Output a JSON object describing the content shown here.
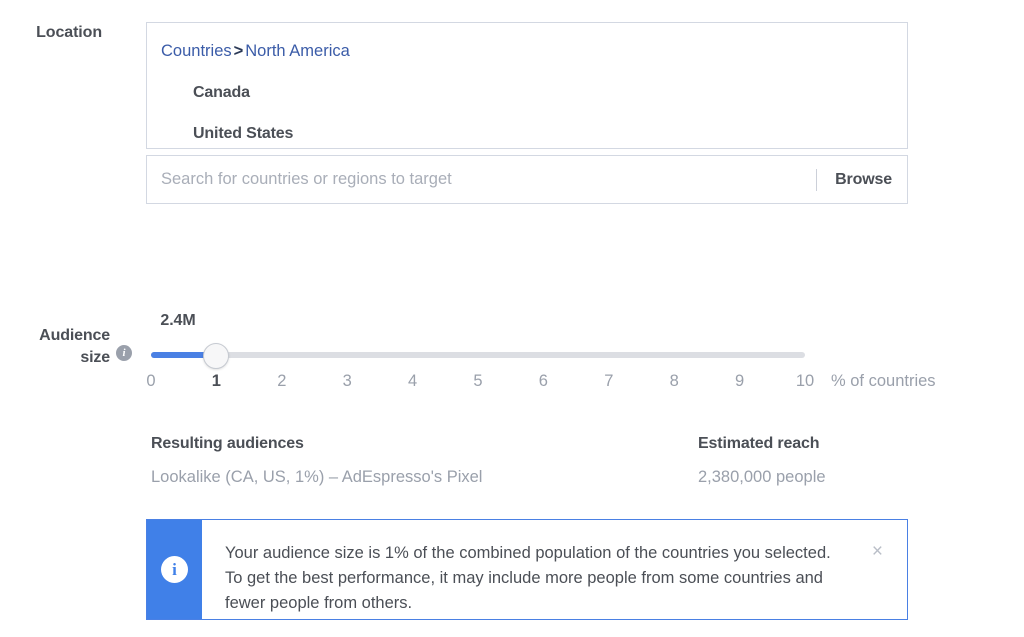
{
  "location": {
    "label": "Location",
    "breadcrumb": {
      "root": "Countries",
      "separator": ">",
      "current": "North America"
    },
    "selected_countries": [
      "Canada",
      "United States"
    ],
    "search": {
      "value": "",
      "placeholder": "Search for countries or regions to target"
    },
    "browse_label": "Browse"
  },
  "audience_size": {
    "label": "Audience\nsize",
    "label_line1": "Audience",
    "label_line2": "size",
    "info_icon": "info-icon",
    "value_label": "2.4M",
    "current_value": 1,
    "min": 0,
    "max": 10,
    "unit_label": "% of countries",
    "ticks": [
      "0",
      "1",
      "2",
      "3",
      "4",
      "5",
      "6",
      "7",
      "8",
      "9",
      "10"
    ],
    "track_color": "#4a80e4",
    "track_bg_color": "#dcdee3"
  },
  "results": {
    "audiences": {
      "heading": "Resulting audiences",
      "value": "Lookalike (CA, US, 1%) – AdEspresso's Pixel"
    },
    "reach": {
      "heading": "Estimated reach",
      "value": "2,380,000 people"
    }
  },
  "info_banner": {
    "icon": "info-icon",
    "text": "Your audience size is 1% of the combined population of the countries you selected. To get the best performance, it may include more people from some countries and fewer people from others.",
    "close_label": "×",
    "accent_color": "#4080e8"
  }
}
